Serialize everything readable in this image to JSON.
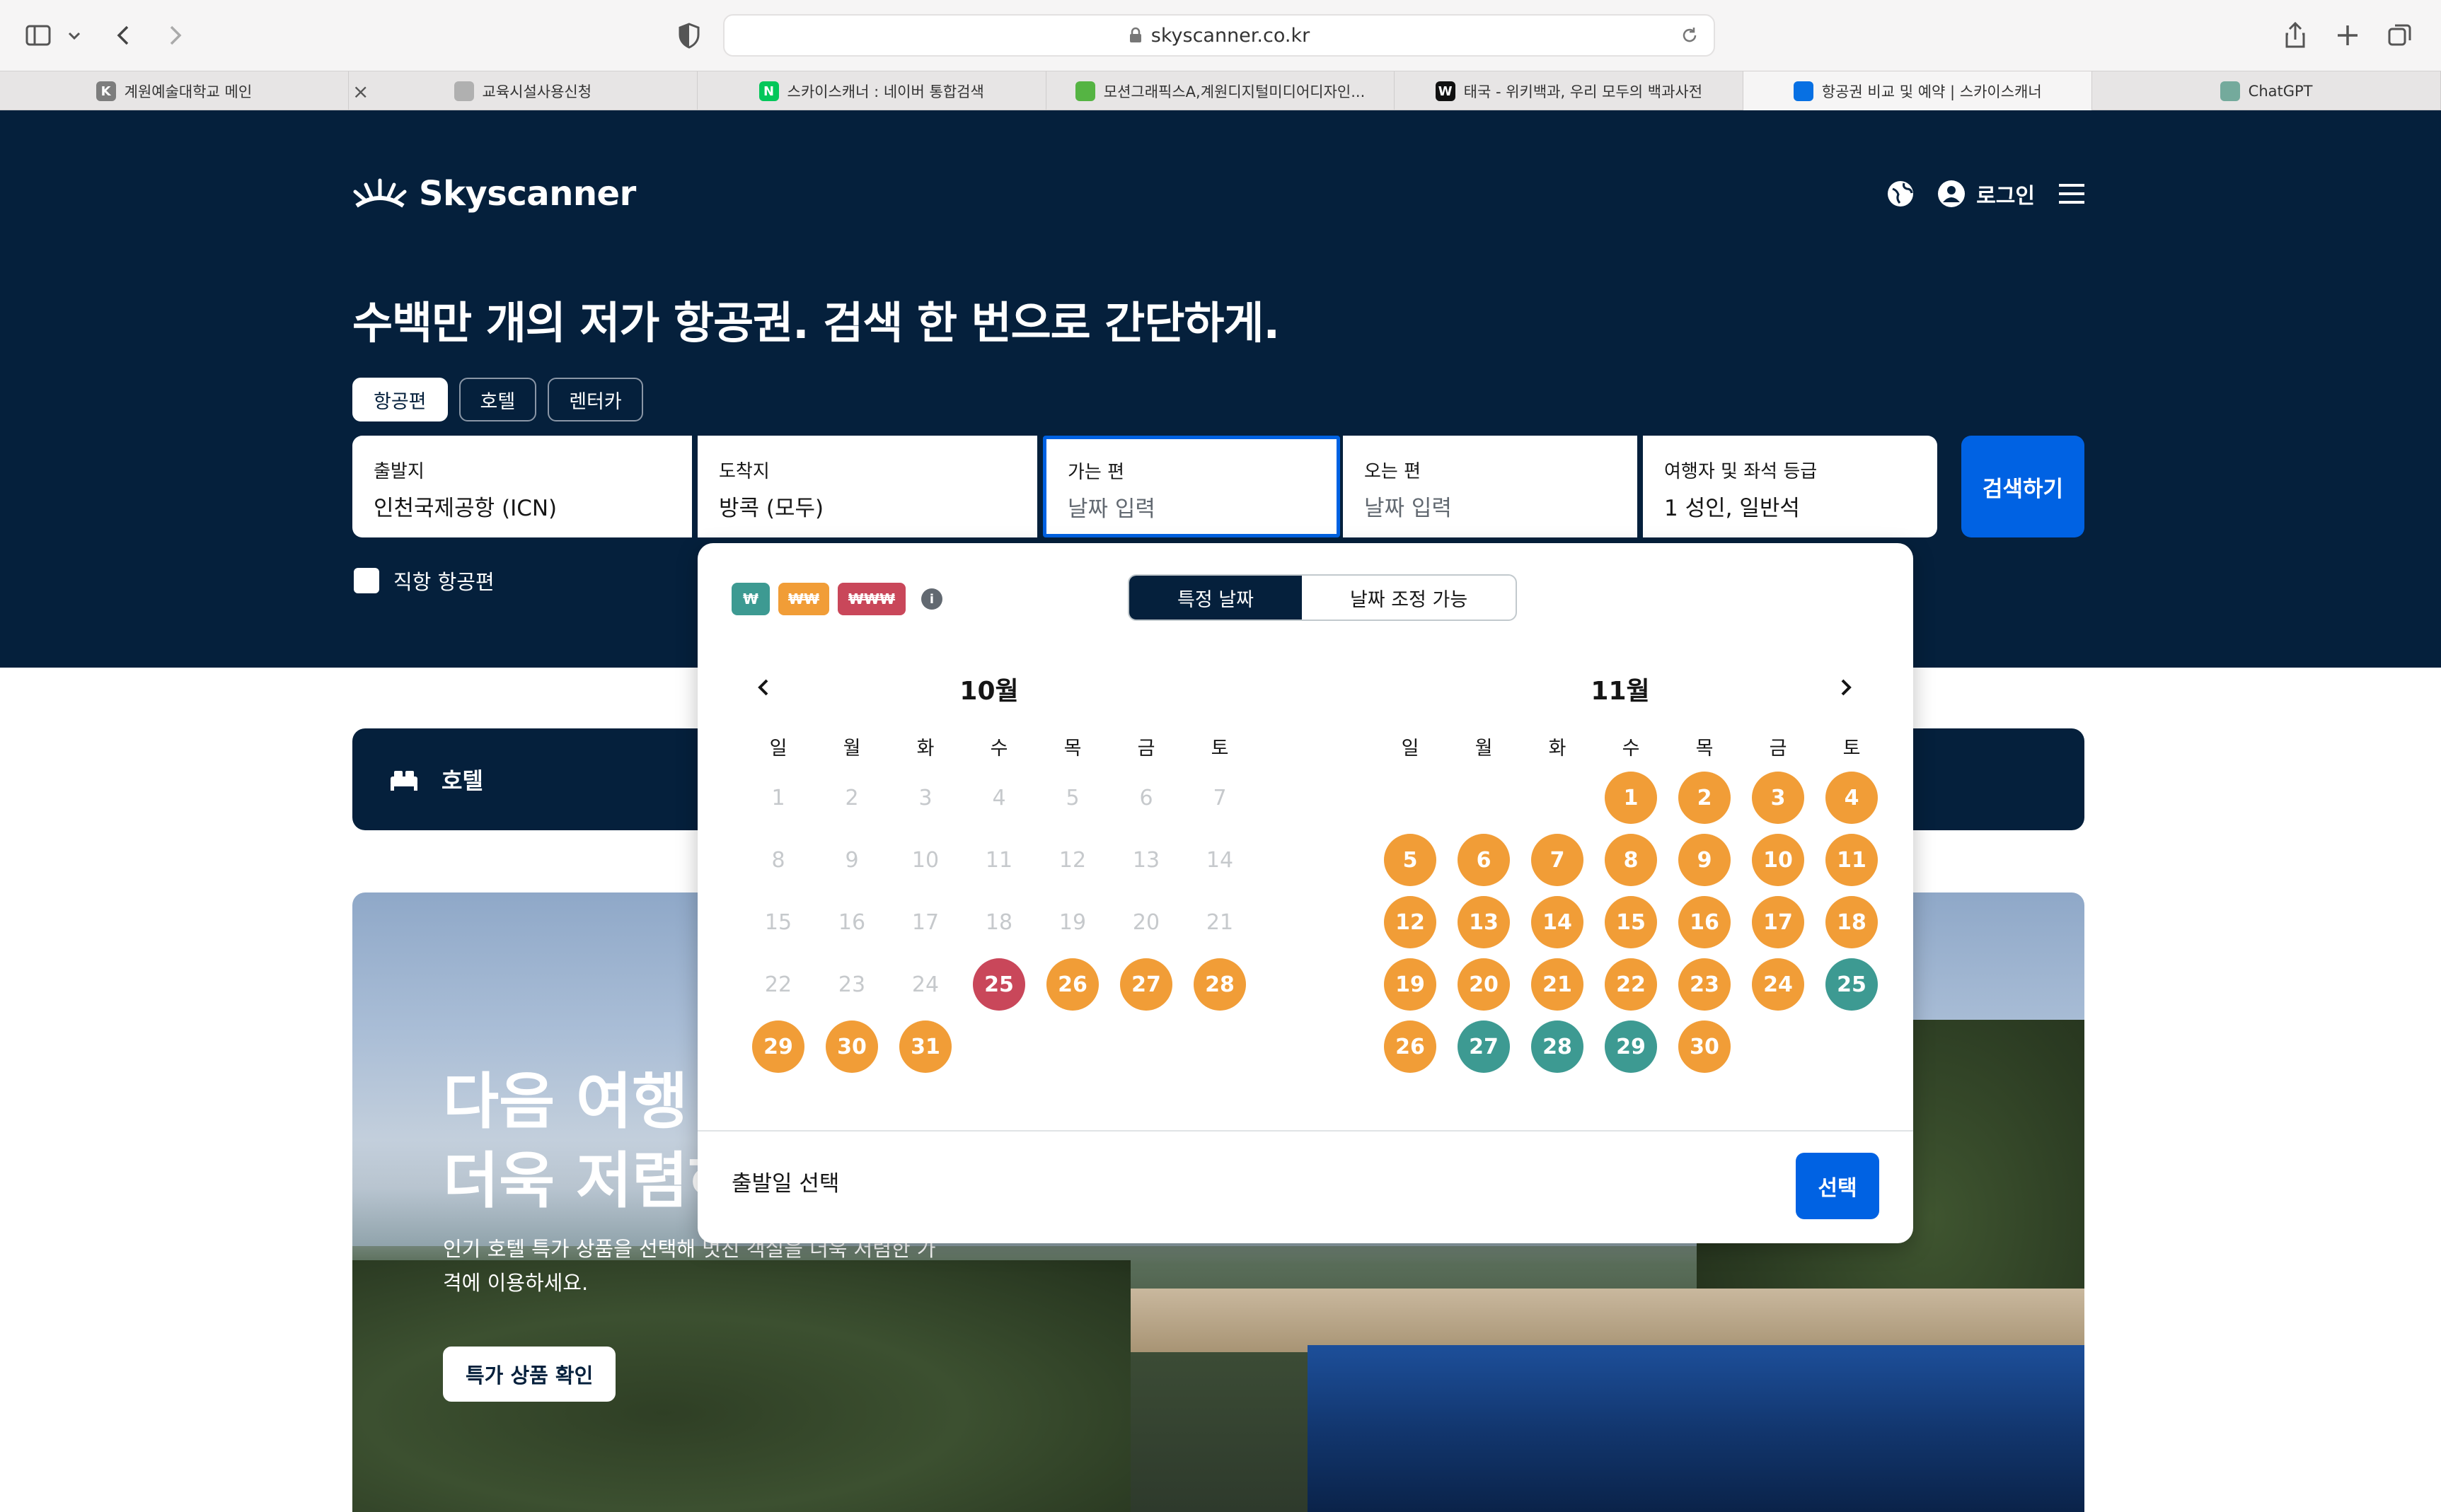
{
  "browser": {
    "url": "skyscanner.co.kr",
    "tabs": [
      {
        "title": "계원예술대학교 메인",
        "fav": "K",
        "favColor": "#7d7d7d"
      },
      {
        "title": "교육시설사용신청",
        "fav": "",
        "favColor": "#b0b0b0"
      },
      {
        "title": "스카이스캐너 : 네이버 통합검색",
        "fav": "N",
        "favColor": "#03c75a"
      },
      {
        "title": "모션그래픽스A,계원디지털미디어디자인...",
        "fav": "",
        "favColor": "#55b443"
      },
      {
        "title": "태국 - 위키백과, 우리 모두의 백과사전",
        "fav": "W",
        "favColor": "#111111"
      },
      {
        "title": "항공권 비교 및 예약 | 스카이스캐너",
        "fav": "",
        "favColor": "#0770e3"
      },
      {
        "title": "ChatGPT",
        "fav": "",
        "favColor": "#74aa9c"
      }
    ],
    "tab_close": "×"
  },
  "header": {
    "brand": "Skyscanner",
    "login": "로그인"
  },
  "hero": {
    "title": "수백만 개의 저가 항공권. 검색 한 번으로 간단하게.",
    "chips": [
      "항공편",
      "호텔",
      "렌터카"
    ],
    "fields": {
      "from_label": "출발지",
      "from_value": "인천국제공항 (ICN)",
      "to_label": "도착지",
      "to_value": "방콕 (모두)",
      "depart_label": "가는 편",
      "depart_value": "날짜 입력",
      "return_label": "오는 편",
      "return_value": "날짜 입력",
      "travelers_label": "여행자 및 좌석 등급",
      "travelers_value": "1 성인, 일반석"
    },
    "search_button": "검색하기",
    "direct_label": "직항 항공편"
  },
  "hotel_bar": {
    "label": "호텔"
  },
  "promo": {
    "title_line1": "다음 여행",
    "title_line2": "더욱 저렴하",
    "subtitle": "인기 호텔 특가 상품을 선택해 멋진 객실을 더욱 저렴한 가격에 이용하세요.",
    "button": "특가 상품 확인"
  },
  "calendar": {
    "price_legend": [
      "₩",
      "₩₩",
      "₩₩₩"
    ],
    "colors": {
      "low": "#3d9a92",
      "mid": "#f19d37",
      "high": "#c9475a"
    },
    "modes": [
      "특정 날짜",
      "날짜 조정 가능"
    ],
    "weekdays": [
      "일",
      "월",
      "화",
      "수",
      "목",
      "금",
      "토"
    ],
    "months": [
      {
        "title": "10월",
        "weeks": [
          [
            {
              "d": "1",
              "s": "past"
            },
            {
              "d": "2",
              "s": "past"
            },
            {
              "d": "3",
              "s": "past"
            },
            {
              "d": "4",
              "s": "past"
            },
            {
              "d": "5",
              "s": "past"
            },
            {
              "d": "6",
              "s": "past"
            },
            {
              "d": "7",
              "s": "past"
            }
          ],
          [
            {
              "d": "8",
              "s": "past"
            },
            {
              "d": "9",
              "s": "past"
            },
            {
              "d": "10",
              "s": "past"
            },
            {
              "d": "11",
              "s": "past"
            },
            {
              "d": "12",
              "s": "past"
            },
            {
              "d": "13",
              "s": "past"
            },
            {
              "d": "14",
              "s": "past"
            }
          ],
          [
            {
              "d": "15",
              "s": "past"
            },
            {
              "d": "16",
              "s": "past"
            },
            {
              "d": "17",
              "s": "past"
            },
            {
              "d": "18",
              "s": "past"
            },
            {
              "d": "19",
              "s": "past"
            },
            {
              "d": "20",
              "s": "past"
            },
            {
              "d": "21",
              "s": "past"
            }
          ],
          [
            {
              "d": "22",
              "s": "past"
            },
            {
              "d": "23",
              "s": "past"
            },
            {
              "d": "24",
              "s": "past"
            },
            {
              "d": "25",
              "s": "high"
            },
            {
              "d": "26",
              "s": "mid"
            },
            {
              "d": "27",
              "s": "mid"
            },
            {
              "d": "28",
              "s": "mid"
            }
          ],
          [
            {
              "d": "29",
              "s": "mid"
            },
            {
              "d": "30",
              "s": "mid"
            },
            {
              "d": "31",
              "s": "mid"
            },
            {
              "d": "",
              "s": "empty"
            },
            {
              "d": "",
              "s": "empty"
            },
            {
              "d": "",
              "s": "empty"
            },
            {
              "d": "",
              "s": "empty"
            }
          ]
        ]
      },
      {
        "title": "11월",
        "weeks": [
          [
            {
              "d": "",
              "s": "empty"
            },
            {
              "d": "",
              "s": "empty"
            },
            {
              "d": "",
              "s": "empty"
            },
            {
              "d": "1",
              "s": "mid"
            },
            {
              "d": "2",
              "s": "mid"
            },
            {
              "d": "3",
              "s": "mid"
            },
            {
              "d": "4",
              "s": "mid"
            }
          ],
          [
            {
              "d": "5",
              "s": "mid"
            },
            {
              "d": "6",
              "s": "mid"
            },
            {
              "d": "7",
              "s": "mid"
            },
            {
              "d": "8",
              "s": "mid"
            },
            {
              "d": "9",
              "s": "mid"
            },
            {
              "d": "10",
              "s": "mid"
            },
            {
              "d": "11",
              "s": "mid"
            }
          ],
          [
            {
              "d": "12",
              "s": "mid"
            },
            {
              "d": "13",
              "s": "mid"
            },
            {
              "d": "14",
              "s": "mid"
            },
            {
              "d": "15",
              "s": "mid"
            },
            {
              "d": "16",
              "s": "mid"
            },
            {
              "d": "17",
              "s": "mid"
            },
            {
              "d": "18",
              "s": "mid"
            }
          ],
          [
            {
              "d": "19",
              "s": "mid"
            },
            {
              "d": "20",
              "s": "mid"
            },
            {
              "d": "21",
              "s": "mid"
            },
            {
              "d": "22",
              "s": "mid"
            },
            {
              "d": "23",
              "s": "mid"
            },
            {
              "d": "24",
              "s": "mid"
            },
            {
              "d": "25",
              "s": "low"
            }
          ],
          [
            {
              "d": "26",
              "s": "mid"
            },
            {
              "d": "27",
              "s": "low"
            },
            {
              "d": "28",
              "s": "low"
            },
            {
              "d": "29",
              "s": "low"
            },
            {
              "d": "30",
              "s": "mid"
            },
            {
              "d": "",
              "s": "empty"
            },
            {
              "d": "",
              "s": "empty"
            }
          ]
        ]
      }
    ],
    "footer_label": "출발일 선택",
    "select_button": "선택"
  }
}
